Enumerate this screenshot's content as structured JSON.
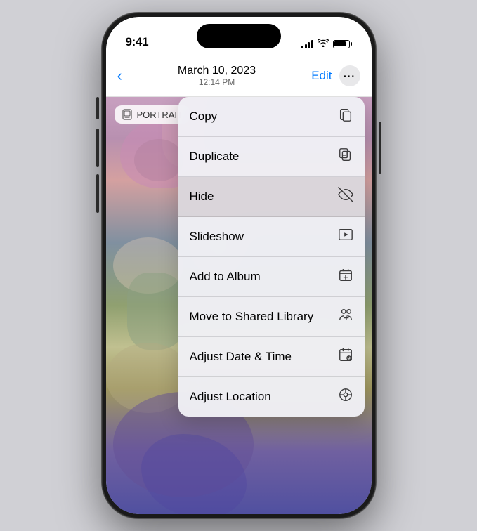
{
  "statusBar": {
    "time": "9:41"
  },
  "navBar": {
    "backLabel": "",
    "title": "March 10, 2023",
    "subtitle": "12:14 PM",
    "editLabel": "Edit"
  },
  "portraitBadge": {
    "label": "PORTRAIT"
  },
  "contextMenu": {
    "items": [
      {
        "id": "copy",
        "label": "Copy",
        "icon": "copy"
      },
      {
        "id": "duplicate",
        "label": "Duplicate",
        "icon": "duplicate"
      },
      {
        "id": "hide",
        "label": "Hide",
        "icon": "hide",
        "highlighted": true
      },
      {
        "id": "slideshow",
        "label": "Slideshow",
        "icon": "slideshow"
      },
      {
        "id": "add-to-album",
        "label": "Add to Album",
        "icon": "add-album"
      },
      {
        "id": "move-shared",
        "label": "Move to Shared Library",
        "icon": "shared-library"
      },
      {
        "id": "adjust-date",
        "label": "Adjust Date & Time",
        "icon": "calendar"
      },
      {
        "id": "adjust-location",
        "label": "Adjust Location",
        "icon": "location"
      }
    ]
  }
}
